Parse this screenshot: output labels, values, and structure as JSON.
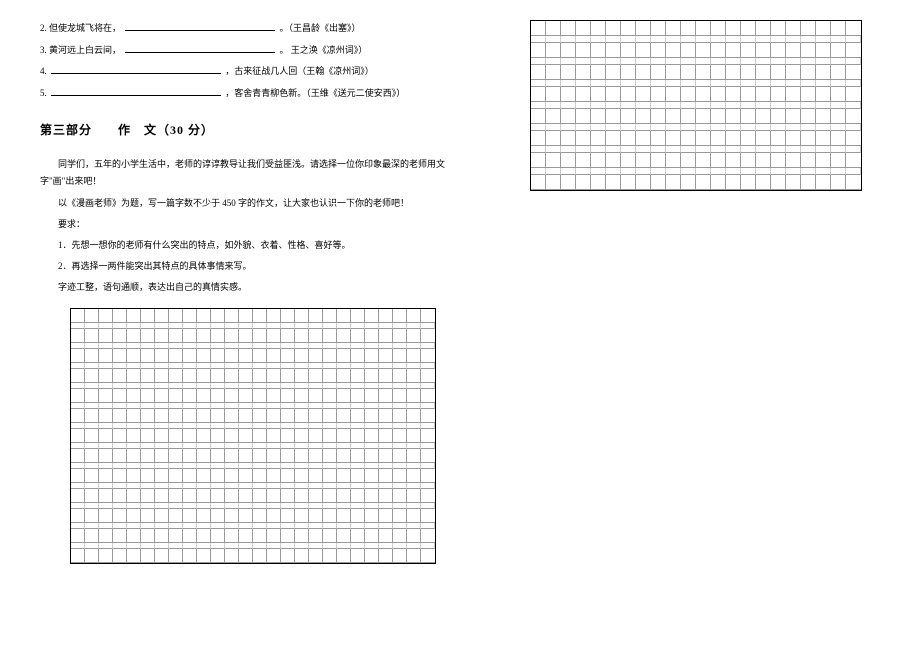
{
  "questions": [
    {
      "num": "2.",
      "pre": "但使龙城飞将在，",
      "blank_w": 150,
      "post": "。（王昌龄《出塞》）"
    },
    {
      "num": "3.",
      "pre": "黄河远上白云间，",
      "blank_w": 150,
      "post": "。 王之涣《凉州词》）"
    },
    {
      "num": "4.",
      "pre": "",
      "blank_w": 170,
      "post": "，古来征战几人回（王翰《凉州词》）"
    },
    {
      "num": "5.",
      "pre": "",
      "blank_w": 170,
      "post": "，客舍青青柳色新。（王维《送元二使安西》）"
    }
  ],
  "section_title": "第三部分　　作　文（30 分）",
  "essay": {
    "intro": "同学们，五年的小学生活中，老师的谆谆教导让我们受益匪浅。请选择一位你印象最深的老师用文字\"画\"出来吧！",
    "topic": "以《漫画老师》为题，写一篇字数不少于 450 字的作文，让大家也认识一下你的老师吧！",
    "req_label": "要求：",
    "req1": "1．先想一想你的老师有什么突出的特点，如外貌、衣着、性格、喜好等。",
    "req2": "2．再选择一两件能突出其特点的具体事情来写。",
    "req3": "字迹工整，语句通顺，表达出自己的真情实感。"
  },
  "left_grid": {
    "cols": 26,
    "rows": 13
  },
  "right_grid": {
    "cols": 22,
    "rows": 8
  }
}
